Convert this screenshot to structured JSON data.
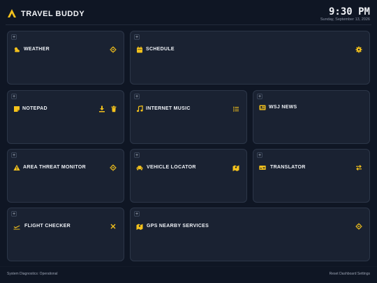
{
  "header": {
    "app_title": "TRAVEL BUDDY",
    "clock": "9:30 PM",
    "date": "Sunday, September 13, 2026"
  },
  "widgets": [
    {
      "title": "WEATHER",
      "icon": "weather-icon",
      "action_icons": [
        "crosshair-icon"
      ]
    },
    {
      "title": "SCHEDULE",
      "icon": "calendar-icon",
      "action_icons": [
        "gear-icon"
      ]
    },
    {
      "title": "NOTEPAD",
      "icon": "note-icon",
      "action_icons": [
        "download-icon",
        "trash-icon"
      ]
    },
    {
      "title": "INTERNET MUSIC",
      "icon": "music-icon",
      "action_icons": [
        "list-icon"
      ]
    },
    {
      "title": "WSJ NEWS",
      "icon": "newspaper-icon",
      "action_icons": []
    },
    {
      "title": "AREA THREAT MONITOR",
      "icon": "warning-icon",
      "action_icons": [
        "crosshair-icon"
      ]
    },
    {
      "title": "VEHICLE LOCATOR",
      "icon": "car-icon",
      "action_icons": [
        "map-icon"
      ]
    },
    {
      "title": "TRANSLATOR",
      "icon": "language-icon",
      "action_icons": [
        "swap-icon"
      ]
    },
    {
      "title": "FLIGHT CHECKER",
      "icon": "plane-icon",
      "action_icons": [
        "close-icon"
      ]
    },
    {
      "title": "GPS NEARBY SERVICES",
      "icon": "map-icon",
      "action_icons": [
        "crosshair-icon"
      ]
    }
  ],
  "add_glyph": "+",
  "footer": {
    "status": "System Diagnostics: Operational",
    "reset": "Reset Dashboard Settings"
  },
  "colors": {
    "accent": "#f4c21c",
    "background": "#0f1624",
    "card": "#1a2232",
    "card_border": "#2c3648"
  }
}
